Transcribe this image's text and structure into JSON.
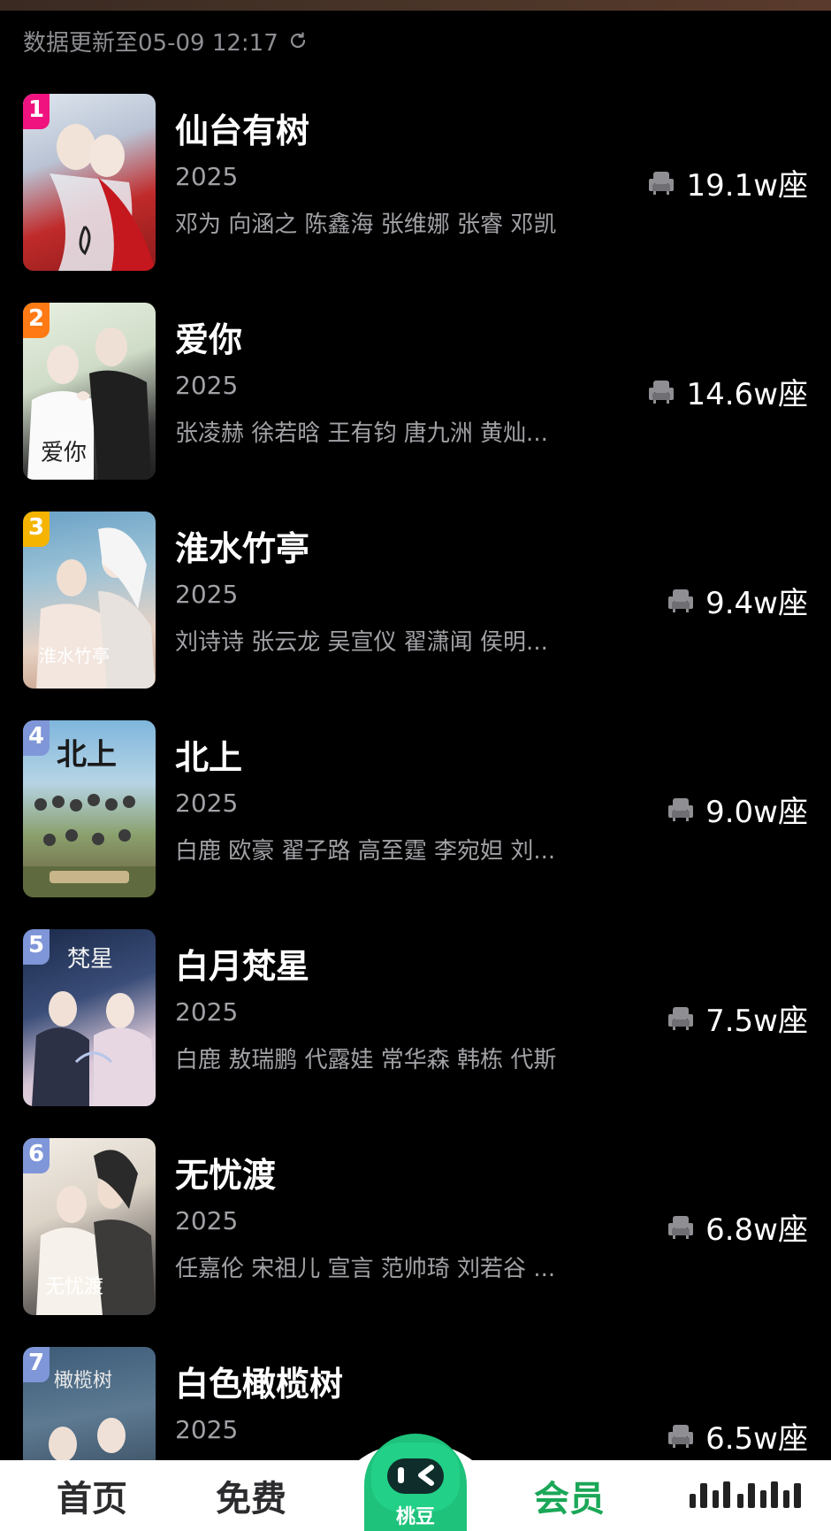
{
  "update": {
    "text": "数据更新至05-09 12:17"
  },
  "items": [
    {
      "rank": "1",
      "title": "仙台有树",
      "year": "2025",
      "cast": "邓为 向涵之 陈鑫海 张维娜 张睿 邓凯",
      "seats": "19.1w座",
      "badge_color": "#f0127e"
    },
    {
      "rank": "2",
      "title": "爱你",
      "year": "2025",
      "cast": "张凌赫 徐若晗 王有钧 唐九洲 黄灿...",
      "seats": "14.6w座",
      "badge_color": "#ff7a14"
    },
    {
      "rank": "3",
      "title": "淮水竹亭",
      "year": "2025",
      "cast": "刘诗诗 张云龙 吴宣仪 翟潇闻 侯明...",
      "seats": "9.4w座",
      "badge_color": "#f5b400"
    },
    {
      "rank": "4",
      "title": "北上",
      "year": "2025",
      "cast": "白鹿 欧豪 翟子路 高至霆 李宛妲 刘...",
      "seats": "9.0w座",
      "badge_color": "#7f96d8"
    },
    {
      "rank": "5",
      "title": "白月梵星",
      "year": "2025",
      "cast": "白鹿 敖瑞鹏 代露娃 常华森 韩栋 代斯",
      "seats": "7.5w座",
      "badge_color": "#7f96d8"
    },
    {
      "rank": "6",
      "title": "无忧渡",
      "year": "2025",
      "cast": "任嘉伦 宋祖儿 宣言 范帅琦 刘若谷 ...",
      "seats": "6.8w座",
      "badge_color": "#7f96d8"
    },
    {
      "rank": "7",
      "title": "白色橄榄树",
      "year": "2025",
      "cast": "",
      "seats": "6.5w座",
      "badge_color": "#7f96d8"
    }
  ],
  "tabbar": {
    "home": "首页",
    "free": "免费",
    "center": "桃豆",
    "vip": "会员"
  }
}
